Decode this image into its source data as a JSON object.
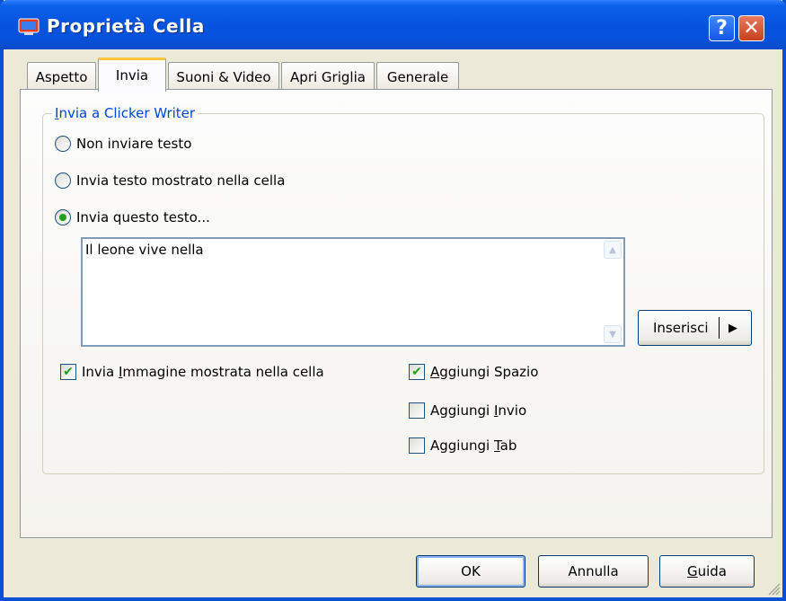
{
  "window": {
    "title": "Proprietà  Cella",
    "help_glyph": "?",
    "close_glyph": "✕"
  },
  "tabs": [
    {
      "label": "Aspetto",
      "active": false
    },
    {
      "label": "Invia",
      "active": true
    },
    {
      "label": "Suoni & Video",
      "active": false
    },
    {
      "label": "Apri Griglia",
      "active": false
    },
    {
      "label": "Generale",
      "active": false
    }
  ],
  "group": {
    "legend_first": "I",
    "legend_rest": "nvia a Clicker Writer"
  },
  "radios": [
    {
      "label": "Non inviare testo",
      "selected": false
    },
    {
      "label": "Invia testo mostrato nella cella",
      "selected": false
    },
    {
      "label": "Invia questo testo...",
      "selected": true
    }
  ],
  "text_field": {
    "value": "Il leone vive nella"
  },
  "insert_button": {
    "label": "Inserisci",
    "arrow": "▶"
  },
  "checkboxes": {
    "send_image": {
      "pre": "Invia ",
      "accel": "I",
      "post": "mmagine mostrata nella cella",
      "checked": true
    },
    "add_space": {
      "pre": "",
      "accel": "A",
      "post": "ggiungi Spazio",
      "checked": true
    },
    "add_enter": {
      "pre": "Aggiungi ",
      "accel": "I",
      "post": "nvio",
      "checked": false
    },
    "add_tab": {
      "pre": "Aggiungi ",
      "accel": "T",
      "post": "ab",
      "checked": false
    }
  },
  "buttons": {
    "ok": "OK",
    "cancel": "Annulla",
    "help_first": "G",
    "help_rest": "uida"
  },
  "colors": {
    "titlebar": "#0654df",
    "legend": "#0046d5",
    "check": "#21a121",
    "active_tab_highlight": "#ffc83c"
  }
}
